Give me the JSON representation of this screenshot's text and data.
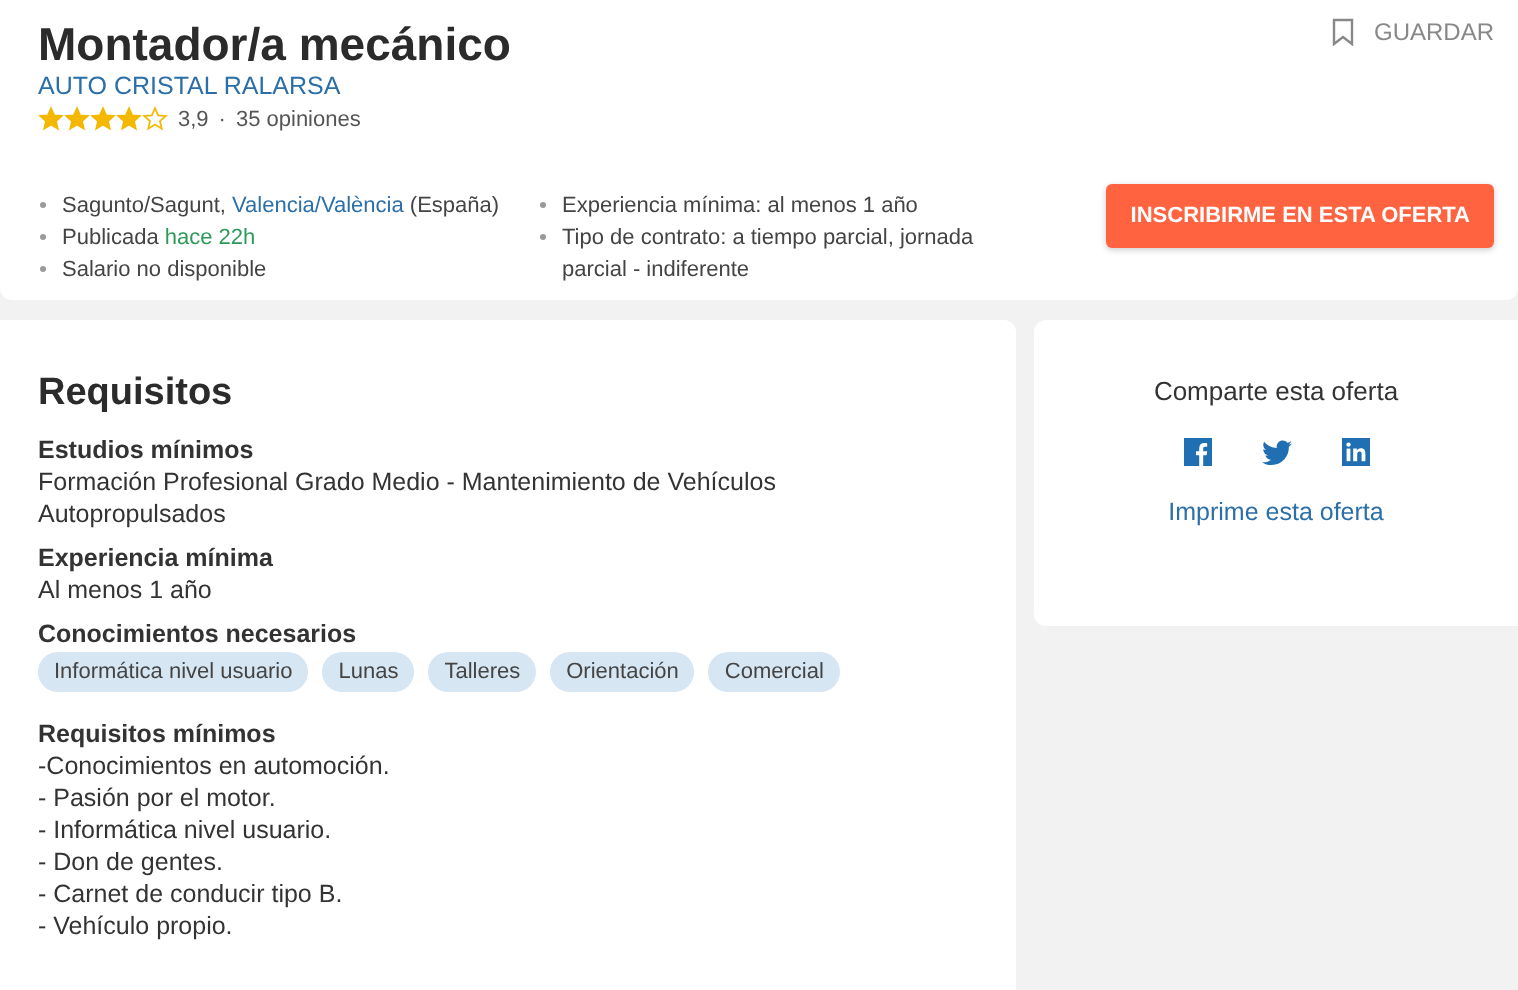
{
  "job": {
    "title": "Montador/a mecánico",
    "company": "AUTO CRISTAL RALARSA",
    "stars": 4,
    "rating": "3,9",
    "separator": "·",
    "reviews": "35 opiniones",
    "save": "GUARDAR"
  },
  "details_left": [
    {
      "text": "Sagunto/Sagunt, ",
      "link": "Valencia/València",
      "color": "#2b6fa8",
      "suffix": " (España)"
    },
    {
      "text": "Publicada ",
      "link": "hace 22h",
      "color": "#2d9a5a"
    },
    {
      "text": "Salario no disponible"
    }
  ],
  "details_right": [
    {
      "text": "Experiencia mínima: al menos 1 año"
    },
    {
      "text": "Tipo de contrato: a tiempo parcial, jornada parcial - indiferente"
    }
  ],
  "apply_button": "INSCRIBIRME EN ESTA OFERTA",
  "requirements": {
    "title": "Requisitos",
    "sections": [
      {
        "heading": "Estudios mínimos",
        "text": "Formación Profesional Grado Medio - Mantenimiento de Vehículos Autopropulsados"
      },
      {
        "heading": "Experiencia mínima",
        "text": "Al menos 1 año"
      }
    ],
    "skills_heading": "Conocimientos necesarios",
    "skills": [
      "Informática nivel usuario",
      "Lunas",
      "Talleres",
      "Orientación",
      "Comercial"
    ],
    "min_heading": "Requisitos mínimos",
    "min_lines": [
      "-Conocimientos en automoción.",
      "- Pasión por el motor.",
      "- Informática nivel usuario.",
      "- Don de gentes.",
      "- Carnet de conducir tipo B.",
      "- Vehículo propio."
    ]
  },
  "share": {
    "title": "Comparte esta oferta",
    "icons": [
      {
        "kind": "facebook"
      },
      {
        "kind": "twitter"
      },
      {
        "kind": "linkedin"
      }
    ],
    "print": "Imprime esta oferta"
  }
}
